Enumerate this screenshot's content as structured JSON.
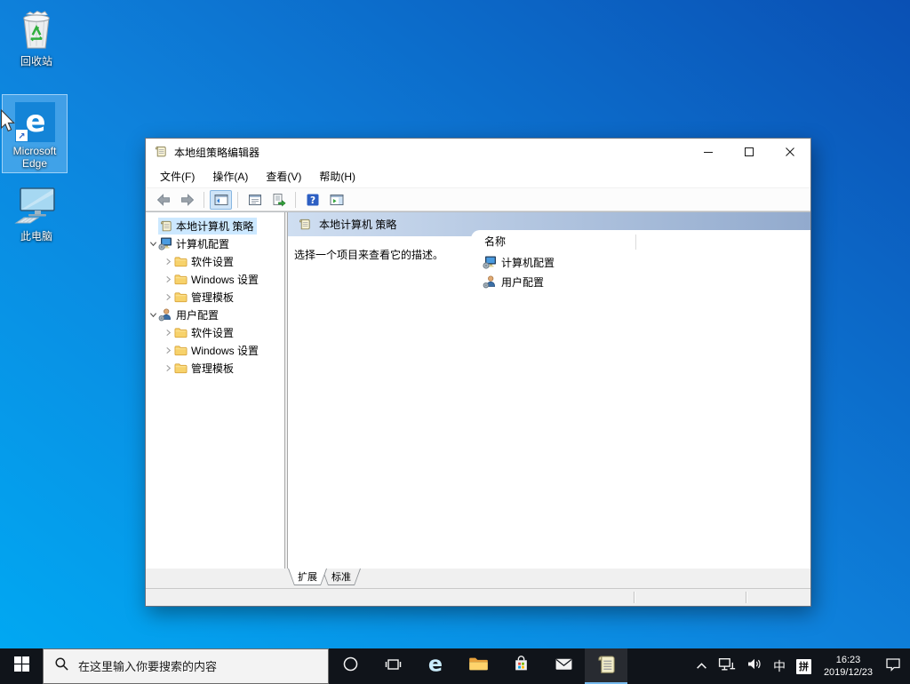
{
  "colors": {
    "desktop-grad-light": "#00aaf3",
    "desktop-grad-mid": "#0e82dc",
    "desktop-grad-dark": "#0a50b4",
    "taskbar-bg": "#10141a",
    "selection": "#cce8ff",
    "accent-underline": "#76b9ed",
    "hdr-grad-a": "#cfdef1",
    "hdr-grad-b": "#92aacd"
  },
  "desktop": {
    "icons": [
      {
        "label": "回收站",
        "icon": "recycle-bin"
      },
      {
        "label": "Microsoft Edge",
        "icon": "edge",
        "selected": true
      },
      {
        "label": "此电脑",
        "icon": "this-pc"
      }
    ]
  },
  "window": {
    "title": "本地组策略编辑器",
    "menu": [
      {
        "label": "文件(F)"
      },
      {
        "label": "操作(A)"
      },
      {
        "label": "查看(V)"
      },
      {
        "label": "帮助(H)"
      }
    ],
    "toolbar": {
      "items": [
        {
          "icon": "back"
        },
        {
          "icon": "forward"
        },
        {
          "sep": true
        },
        {
          "icon": "show-console-tree",
          "active": true
        },
        {
          "sep": true
        },
        {
          "icon": "properties"
        },
        {
          "icon": "export-list"
        },
        {
          "sep": true
        },
        {
          "icon": "help"
        },
        {
          "icon": "show-action-pane"
        }
      ]
    },
    "tree": {
      "items": [
        {
          "label": "本地计算机 策略",
          "icon": "scroll",
          "level": 0,
          "selected": true
        },
        {
          "label": "计算机配置",
          "icon": "computer",
          "level": 1,
          "expand": "expanded"
        },
        {
          "label": "软件设置",
          "icon": "folder",
          "level": 2,
          "expand": "collapsed"
        },
        {
          "label": "Windows 设置",
          "icon": "folder",
          "level": 2,
          "expand": "collapsed"
        },
        {
          "label": "管理模板",
          "icon": "folder",
          "level": 2,
          "expand": "collapsed"
        },
        {
          "label": "用户配置",
          "icon": "user",
          "level": 1,
          "expand": "expanded"
        },
        {
          "label": "软件设置",
          "icon": "folder",
          "level": 2,
          "expand": "collapsed"
        },
        {
          "label": "Windows 设置",
          "icon": "folder",
          "level": 2,
          "expand": "collapsed"
        },
        {
          "label": "管理模板",
          "icon": "folder",
          "level": 2,
          "expand": "collapsed"
        }
      ]
    },
    "result": {
      "header_title": "本地计算机 策略",
      "description": "选择一个项目来查看它的描述。",
      "column_header": "名称",
      "items": [
        {
          "label": "计算机配置",
          "icon": "computer"
        },
        {
          "label": "用户配置",
          "icon": "user"
        }
      ]
    },
    "tabs": [
      {
        "label": "扩展",
        "active": true
      },
      {
        "label": "标准"
      }
    ]
  },
  "taskbar": {
    "search_placeholder": "在这里输入你要搜索的内容",
    "ime_lang": "中",
    "ime_mode": "拼",
    "time": "16:23",
    "date": "2019/12/23"
  }
}
